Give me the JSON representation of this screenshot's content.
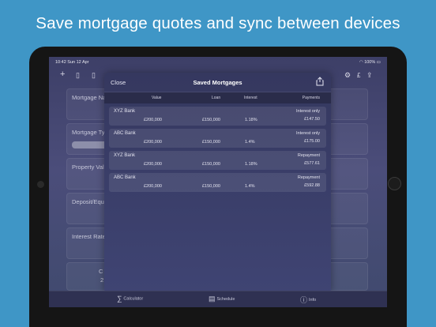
{
  "headline": "Save mortgage quotes and sync between devices",
  "status_bar": {
    "time": "10:42  Sun 12 Apr",
    "battery": "100%"
  },
  "toolbar": {
    "currency": "£"
  },
  "background_form": {
    "fields": [
      "Mortgage Na",
      "Mortgage Ty",
      "Property Valu",
      "Deposit/Equ",
      "Interest Rate"
    ],
    "partial": "C",
    "partial_value": "2"
  },
  "modal": {
    "close_label": "Close",
    "title": "Saved Mortgages",
    "columns": [
      "Value",
      "Loan",
      "Interest",
      "Payments"
    ],
    "rows": [
      {
        "bank": "XYZ Bank",
        "value": "£200,000",
        "loan": "£150,000",
        "interest": "1.18%",
        "payment_type": "Interest only",
        "payment": "£147.50"
      },
      {
        "bank": "ABC Bank",
        "value": "£200,000",
        "loan": "£150,000",
        "interest": "1.4%",
        "payment_type": "Interest only",
        "payment": "£175.00"
      },
      {
        "bank": "XYZ Bank",
        "value": "£200,000",
        "loan": "£150,000",
        "interest": "1.18%",
        "payment_type": "Repayment",
        "payment": "£577.61"
      },
      {
        "bank": "ABC Bank",
        "value": "£200,000",
        "loan": "£150,000",
        "interest": "1.4%",
        "payment_type": "Repayment",
        "payment": "£592.88"
      }
    ]
  },
  "tabbar": {
    "tabs": [
      "Calculator",
      "Schedule",
      "Info"
    ]
  }
}
